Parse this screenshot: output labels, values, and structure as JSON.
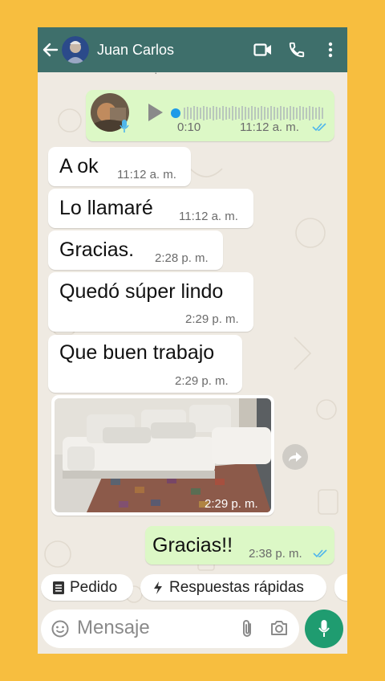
{
  "header": {
    "contact_name": "Juan Carlos"
  },
  "voice_note": {
    "duration": "0:10",
    "time": "11:12 a. m."
  },
  "messages": [
    {
      "text": "A ok",
      "time": "11:12 a. m."
    },
    {
      "text": "Lo llamaré",
      "time": "11:12 a. m."
    },
    {
      "text": "Gracias.",
      "time": "2:28 p. m."
    },
    {
      "text": "Quedó súper lindo",
      "time": "2:29 p. m."
    },
    {
      "text": "Que buen trabajo",
      "time": "2:29 p. m."
    }
  ],
  "photo_message": {
    "time": "2:29 p. m."
  },
  "outgoing_message": {
    "text": "Gracias!!",
    "time": "2:38 p. m."
  },
  "quick_chips": [
    {
      "label": "Pedido",
      "icon": "receipt-icon"
    },
    {
      "label": "Respuestas rápidas",
      "icon": "lightning-icon"
    }
  ],
  "composer": {
    "placeholder": "Mensaje"
  },
  "colors": {
    "header": "#3E6F6B",
    "outgoing_bubble": "#DCF8C6",
    "read_ticks": "#4FB6EC",
    "mic_button": "#1F9C70",
    "background": "#F7BE3F"
  }
}
